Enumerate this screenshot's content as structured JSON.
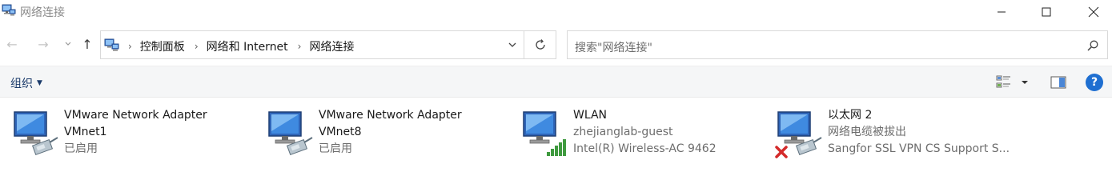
{
  "window": {
    "title": "网络连接"
  },
  "nav": {
    "back": "←",
    "forward": "→",
    "recent": "⌄",
    "up": "↑"
  },
  "address": {
    "crumbs": [
      "控制面板",
      "网络和 Internet",
      "网络连接"
    ]
  },
  "search": {
    "placeholder": "搜索\"网络连接\""
  },
  "toolbar": {
    "organize_label": "组织",
    "help_label": "?"
  },
  "connections": [
    {
      "name_line1": "VMware Network Adapter",
      "name_line2": "VMnet1",
      "status": "已启用",
      "device": "",
      "icon": "wired-adapter-icon",
      "disconnected": false
    },
    {
      "name_line1": "VMware Network Adapter",
      "name_line2": "VMnet8",
      "status": "已启用",
      "device": "",
      "icon": "wired-adapter-icon",
      "disconnected": false
    },
    {
      "name_line1": "WLAN",
      "name_line2": "",
      "status": "zhejianglab-guest",
      "device": "Intel(R) Wireless-AC 9462",
      "icon": "wireless-adapter-icon",
      "disconnected": false
    },
    {
      "name_line1": "以太网 2",
      "name_line2": "",
      "status": "网络电缆被拔出",
      "device": "Sangfor SSL VPN CS Support S...",
      "icon": "ethernet-adapter-icon",
      "disconnected": true
    }
  ],
  "colors": {
    "accent": "#1f6fd1",
    "link": "#1a3a6a",
    "muted": "#6d6d6d",
    "error": "#d42a2a",
    "signal": "#3f9a3f"
  }
}
